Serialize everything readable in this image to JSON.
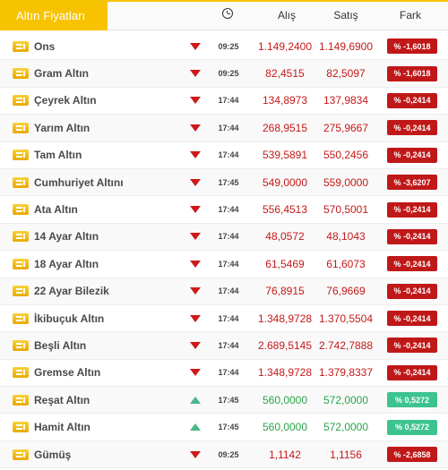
{
  "header": {
    "title": "Altın Fiyatları",
    "col_time_icon": "clock-icon",
    "col_alis": "Alış",
    "col_satis": "Satış",
    "col_fark": "Fark"
  },
  "colors": {
    "accent": "#f7c300",
    "down": "#c01818",
    "up": "#3dc38f"
  },
  "rows": [
    {
      "name": "Ons",
      "trend": "down",
      "time": "09:25",
      "alis": "1.149,2400",
      "satis": "1.149,6900",
      "fark": "% -1,6018"
    },
    {
      "name": "Gram Altın",
      "trend": "down",
      "time": "09:25",
      "alis": "82,4515",
      "satis": "82,5097",
      "fark": "% -1,6018"
    },
    {
      "name": "Çeyrek Altın",
      "trend": "down",
      "time": "17:44",
      "alis": "134,8973",
      "satis": "137,9834",
      "fark": "% -0,2414"
    },
    {
      "name": "Yarım Altın",
      "trend": "down",
      "time": "17:44",
      "alis": "268,9515",
      "satis": "275,9667",
      "fark": "% -0,2414"
    },
    {
      "name": "Tam Altın",
      "trend": "down",
      "time": "17:44",
      "alis": "539,5891",
      "satis": "550,2456",
      "fark": "% -0,2414"
    },
    {
      "name": "Cumhuriyet Altını",
      "trend": "down",
      "time": "17:45",
      "alis": "549,0000",
      "satis": "559,0000",
      "fark": "% -3,6207"
    },
    {
      "name": "Ata Altın",
      "trend": "down",
      "time": "17:44",
      "alis": "556,4513",
      "satis": "570,5001",
      "fark": "% -0,2414"
    },
    {
      "name": "14 Ayar Altın",
      "trend": "down",
      "time": "17:44",
      "alis": "48,0572",
      "satis": "48,1043",
      "fark": "% -0,2414"
    },
    {
      "name": "18 Ayar Altın",
      "trend": "down",
      "time": "17:44",
      "alis": "61,5469",
      "satis": "61,6073",
      "fark": "% -0,2414"
    },
    {
      "name": "22 Ayar Bilezik",
      "trend": "down",
      "time": "17:44",
      "alis": "76,8915",
      "satis": "76,9669",
      "fark": "% -0,2414"
    },
    {
      "name": "İkibuçuk Altın",
      "trend": "down",
      "time": "17:44",
      "alis": "1.348,9728",
      "satis": "1.370,5504",
      "fark": "% -0,2414"
    },
    {
      "name": "Beşli Altın",
      "trend": "down",
      "time": "17:44",
      "alis": "2.689,5145",
      "satis": "2.742,7888",
      "fark": "% -0,2414"
    },
    {
      "name": "Gremse Altın",
      "trend": "down",
      "time": "17:44",
      "alis": "1.348,9728",
      "satis": "1.379,8337",
      "fark": "% -0,2414"
    },
    {
      "name": "Reşat Altın",
      "trend": "up",
      "time": "17:45",
      "alis": "560,0000",
      "satis": "572,0000",
      "fark": "% 0,5272"
    },
    {
      "name": "Hamit Altın",
      "trend": "up",
      "time": "17:45",
      "alis": "560,0000",
      "satis": "572,0000",
      "fark": "% 0,5272"
    },
    {
      "name": "Gümüş",
      "trend": "down",
      "time": "09:25",
      "alis": "1,1142",
      "satis": "1,1156",
      "fark": "% -2,6858"
    }
  ]
}
